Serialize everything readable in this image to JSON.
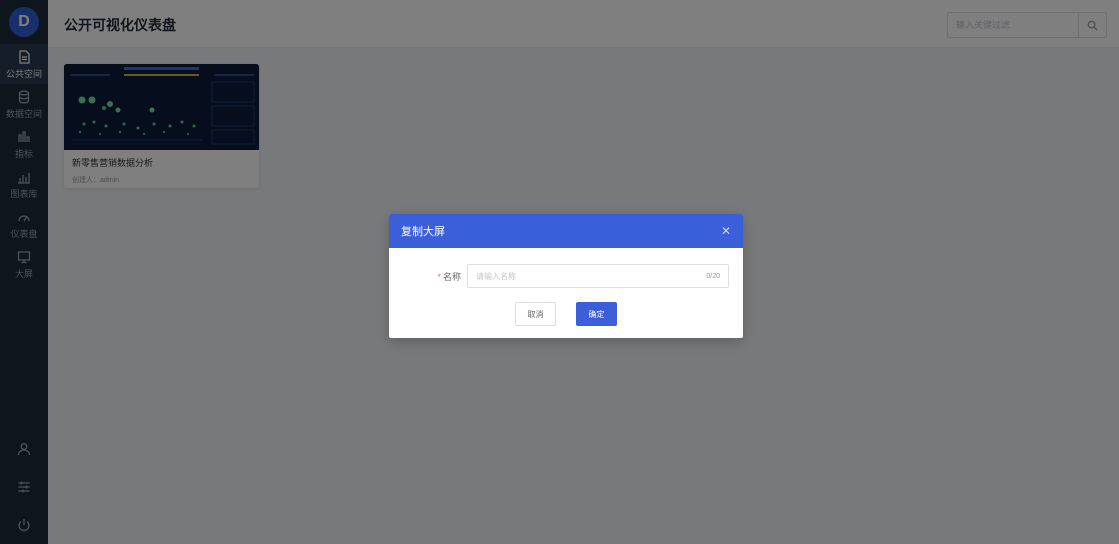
{
  "sidebar": {
    "logo": "D",
    "items": [
      {
        "label": "公共空间",
        "icon": "document-icon",
        "active": true
      },
      {
        "label": "数据空间",
        "icon": "database-icon",
        "active": false
      },
      {
        "label": "指标",
        "icon": "bar-chart-icon",
        "active": false
      },
      {
        "label": "图表库",
        "icon": "chart-library-icon",
        "active": false
      },
      {
        "label": "仪表盘",
        "icon": "gauge-icon",
        "active": false
      },
      {
        "label": "大屏",
        "icon": "monitor-icon",
        "active": false
      }
    ],
    "bottom_icons": [
      "user-icon",
      "settings-sliders-icon",
      "power-icon"
    ]
  },
  "header": {
    "title": "公开可视化仪表盘",
    "search_placeholder": "输入关键过滤"
  },
  "cards": [
    {
      "title": "新零售营销数据分析",
      "creator": "创建人：admin"
    }
  ],
  "modal": {
    "title": "复制大屏",
    "required_mark": "*",
    "name_label": "名称",
    "name_placeholder": "请输入名称",
    "name_value": "",
    "counter": "0/20",
    "cancel_label": "取消",
    "ok_label": "确定"
  },
  "colors": {
    "sidebar_bg": "#1f2a3a",
    "primary": "#3a5fd9",
    "overlay": "rgba(0,0,0,0.5)"
  }
}
